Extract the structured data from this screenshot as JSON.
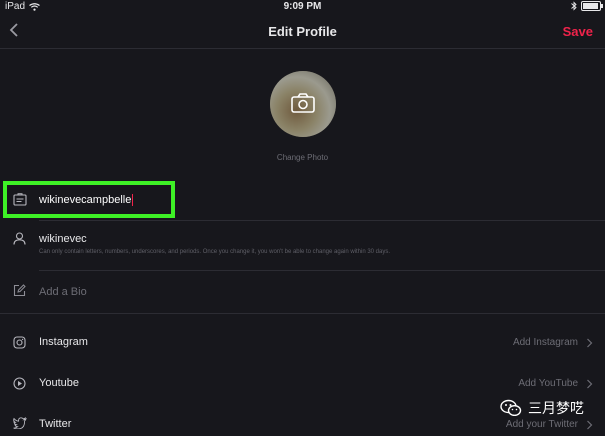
{
  "status_bar": {
    "device": "iPad",
    "time": "9:09 PM"
  },
  "nav": {
    "title": "Edit Profile",
    "save_label": "Save"
  },
  "avatar": {
    "change_photo_label": "Change Photo"
  },
  "fields": {
    "name": {
      "value": "wikinevecampbelle"
    },
    "username": {
      "value": "wikinevec",
      "hint": "Can only contain letters, numbers, underscores, and periods. Once you change it, you won't be able to change again within 30 days."
    },
    "bio": {
      "placeholder": "Add a Bio"
    }
  },
  "social": [
    {
      "label": "Instagram",
      "action": "Add Instagram",
      "icon": "instagram-icon"
    },
    {
      "label": "Youtube",
      "action": "Add YouTube",
      "icon": "youtube-icon"
    },
    {
      "label": "Twitter",
      "action": "Add your Twitter",
      "icon": "twitter-icon"
    }
  ],
  "watermark": {
    "text": "三月梦呓"
  },
  "colors": {
    "background": "#17171c",
    "accent": "#f0234b",
    "highlight": "#3ef126"
  }
}
